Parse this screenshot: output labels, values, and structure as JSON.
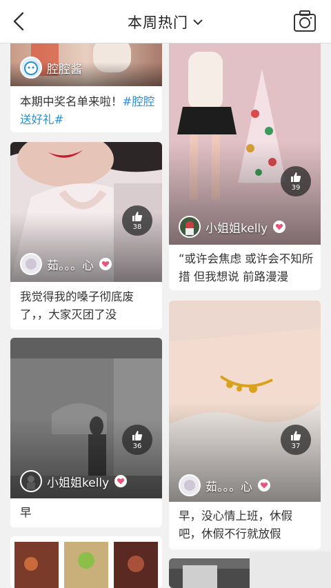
{
  "header": {
    "title": "本周热门"
  },
  "cards": {
    "c1": {
      "user": "腔腔酱",
      "caption": "本期中奖名单来啦！",
      "tag": "#腔腔送好礼#"
    },
    "c2": {
      "user": "小姐姐kelly",
      "likes": "39",
      "caption": "“或许会焦虑 或许会不知所措 但我想说 前路漫漫"
    },
    "c3": {
      "user": "茹。。。心",
      "likes": "38",
      "caption": "我觉得我的嗓子彻底废了，，大家灭团了没"
    },
    "c4": {
      "user": "茹。。。心",
      "likes": "37",
      "caption": "早，没心情上班，休假吧，休假不行就放假"
    },
    "c5": {
      "user": "小姐姐kelly",
      "likes": "36",
      "caption": "早"
    }
  },
  "colors": {
    "tag": "#2b8fd2",
    "heart": "#e9557d",
    "header_bg": "#ffffff",
    "page_bg": "#f1f1f1"
  }
}
